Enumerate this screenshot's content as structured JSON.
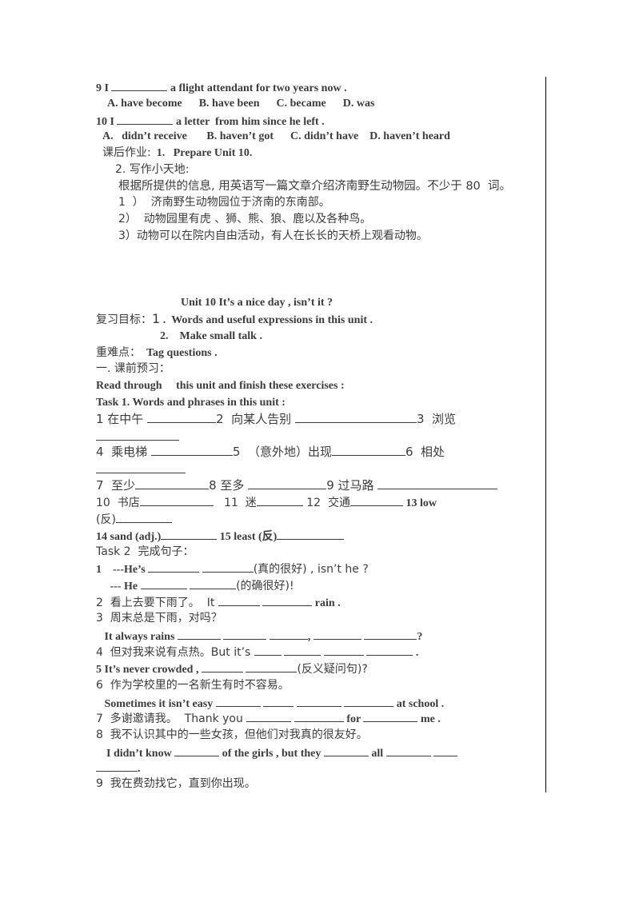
{
  "section_a": {
    "q9": {
      "prefix": "9 I ",
      "suffix": " a flight attendant for two years now .",
      "options": "A. have become      B. have been      C. became      D. was"
    },
    "q10": {
      "prefix": "10 I ",
      "suffix": " a letter  from him since he left .",
      "options": "A.   didn’t receive       B. haven’t got      C. didn’t have    D. haven’t heard"
    },
    "homework": {
      "label": "课后作业:",
      "item1": "  1.   Prepare Unit 10."
    },
    "writing": {
      "title": "2. 写作小天地:",
      "instruction": "根据所提供的信息, 用英语写一篇文章介绍济南野生动物园。不少于 80  词。",
      "points": [
        "1  ）  济南野生动物园位于济南的东南部。",
        "2）  动物园里有虎 、狮、熊、狼、鹿以及各种鸟。",
        "3）动物可以在院内自由活动，有人在长长的天桥上观看动物。"
      ]
    }
  },
  "unit": {
    "title": "Unit 10 It’s a nice day , isn’t it ?",
    "goals_label": "复习目标：",
    "goal1_num": "1",
    "goal1": " .  Words and useful expressions in this unit .",
    "goal2": "2.    Make small talk .",
    "key_label": "重难点：",
    "key": "  Tag questions .",
    "preview_label": "一. 课前预习：",
    "read_through": "Read through     this unit and finish these exercises :",
    "task1_title": "Task 1. Words and phrases in this unit :",
    "task1_lines": [
      [
        "1 在中午 ",
        "2  向某人告别 ",
        "3  浏览"
      ],
      [
        "4  乘电梯 ",
        "5  （意外地）出现",
        "6  相处"
      ],
      [
        "7  至少",
        "8 至多 ",
        "9 过马路 "
      ],
      [
        "10  书店",
        "   11  迷",
        " 12  交通",
        " 13 low"
      ],
      [
        "(反)"
      ],
      [
        "14 sand (adj.)",
        " 15 least (反)"
      ]
    ],
    "task2_title": "Task 2  完成句子：",
    "task2": [
      {
        "a": "1    ---He’s ",
        "b": "(真的很好) , isn’t he ?"
      },
      {
        "a": "     --- He ",
        "b": "(的确很好)!"
      },
      {
        "a": "2  看上去要下雨了。  It ",
        "b": " rain ."
      },
      {
        "a": "3  周末总是下雨，对吗？"
      },
      {
        "a": "   It always rains ",
        "b": ", ",
        "c": "?"
      },
      {
        "a": "4  但对我来说有点热。But it’s ",
        "b": " ."
      },
      {
        "a": "5 It’s never crowded , ",
        "b": "(反义疑问句)?"
      },
      {
        "a": "6  作为学校里的一名新生有时不容易。"
      },
      {
        "a": "   Sometimes it isn’t easy ",
        "b": " at school ."
      },
      {
        "a": "7  多谢邀请我。  Thank you ",
        "b": " for ",
        "c": " me ."
      },
      {
        "a": "8  我不认识其中的一些女孩，但他们对我真的很友好。"
      },
      {
        "a": "  I didn’t know ",
        "b": " of the girls , but they ",
        "c": " all "
      },
      {
        "a": "."
      },
      {
        "a": "9  我在费劲找它，直到你出现。"
      }
    ]
  }
}
